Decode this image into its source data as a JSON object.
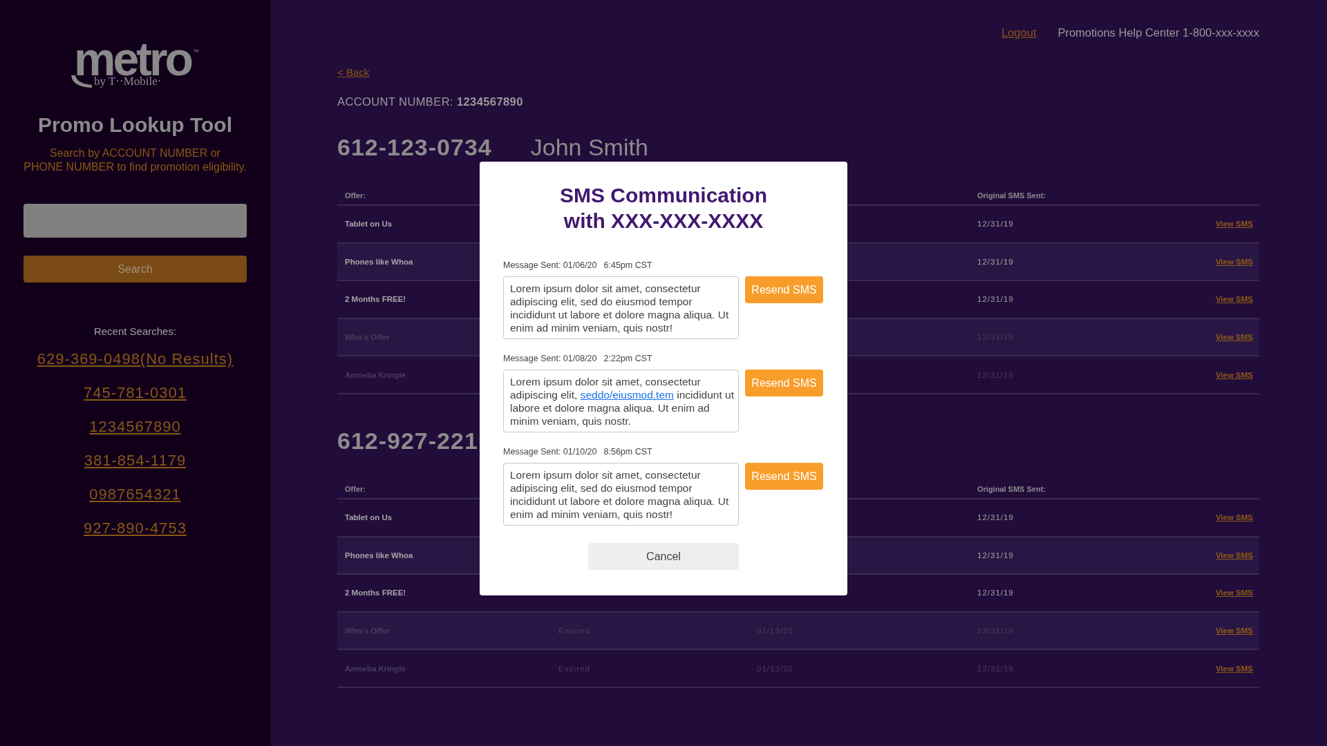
{
  "sidebar": {
    "logo": {
      "wordmark": "metro",
      "trademark": "™",
      "tagline": "by T··Mobile·"
    },
    "title": "Promo Lookup Tool",
    "subtitle": "Search by ACCOUNT NUMBER or\nPHONE NUMBER to find promotion eligibility.",
    "search_button": "Search",
    "recent_label": "Recent Searches:",
    "recent_searches": [
      "629-369-0498(No Results)",
      "745-781-0301",
      "1234567890",
      "381-854-1179",
      "0987654321",
      "927-890-4753"
    ]
  },
  "top_bar": {
    "logout": "Logout",
    "help": "Promotions Help Center 1-800-xxx-xxxx"
  },
  "back": "< Back",
  "account_number": "ACCOUNT NUMBER: **1234567890**",
  "accounts": [
    {
      "phone": "612-123-0734",
      "name": "John Smith",
      "table": {
        "columns": {
          "offer": "Offer:",
          "original_sms_sent": "Original SMS Sent:"
        },
        "rows": [
          {
            "offer": "Tablet on Us",
            "original_sms_sent": "12/31/19",
            "action": "View SMS",
            "disabled": false
          },
          {
            "offer": "Phones like Whoa",
            "original_sms_sent": "12/31/19",
            "action": "View SMS",
            "disabled": false
          },
          {
            "offer": "2 Months FREE!",
            "original_sms_sent": "12/31/19",
            "action": "View SMS",
            "disabled": false
          },
          {
            "offer": "Who's Offer",
            "original_sms_sent": "12/31/19",
            "action": "View SMS",
            "disabled": true
          },
          {
            "offer": "Amoeba Kringle",
            "original_sms_sent": "12/31/19",
            "action": "View SMS",
            "disabled": true
          }
        ]
      }
    },
    {
      "phone": "612-927-221",
      "table": {
        "columns": {
          "offer": "Offer:",
          "original_sms_sent": "Original SMS Sent:"
        },
        "rows": [
          {
            "offer": "Tablet on Us",
            "original_sms_sent": "12/31/19",
            "action": "View SMS",
            "disabled": false
          },
          {
            "offer": "Phones like Whoa",
            "original_sms_sent": "12/31/19",
            "action": "View SMS",
            "disabled": false
          },
          {
            "offer": "2 Months FREE!",
            "original_sms_sent": "12/31/19",
            "action": "View SMS",
            "disabled": false
          },
          {
            "offer": "Who's Offer",
            "column_2": "Expired",
            "column_3": "01/13/20",
            "original_sms_sent": "12/31/19",
            "action": "View SMS",
            "disabled": true
          },
          {
            "offer": "Amoeba Kringle",
            "column_2": "Expired",
            "column_3": "01/13/20",
            "original_sms_sent": "12/31/19",
            "action": "View SMS",
            "disabled": true
          }
        ]
      }
    }
  ],
  "dialog": {
    "title": "SMS Communication\nwith XXX-XXX-XXXX",
    "messages": [
      {
        "sent": "Message Sent: 01/06/20",
        "time": "6:45pm CST",
        "body": [
          {
            "kind": "text",
            "text": "Lorem ipsum dolor sit amet, consectetur adipiscing elit, sed do eiusmod tempor incididunt ut labore et dolore magna aliqua. Ut enim ad minim veniam, quis nostr!"
          }
        ],
        "button": "Resend SMS"
      },
      {
        "sent": "Message Sent: 01/08/20",
        "time": "2:22pm CST",
        "body": [
          {
            "kind": "text",
            "text": "Lorem ipsum dolor sit amet, consectetur adipiscing elit, "
          },
          {
            "kind": "link",
            "text": "seddo/eiusmod.tem"
          },
          {
            "kind": "text",
            "text": " incididunt ut labore et dolore magna aliqua. Ut enim ad minim veniam, quis nostr."
          }
        ],
        "button": "Resend SMS"
      },
      {
        "sent": "Message Sent: 01/10/20",
        "time": "8:56pm CST",
        "body": [
          {
            "kind": "text",
            "text": "Lorem ipsum dolor sit amet, consectetur adipiscing elit, sed do eiusmod tempor incididunt ut labore et dolore magna aliqua. Ut enim ad minim veniam, quis nostr!"
          }
        ],
        "button": "Resend SMS"
      }
    ],
    "cancel": "Cancel"
  }
}
